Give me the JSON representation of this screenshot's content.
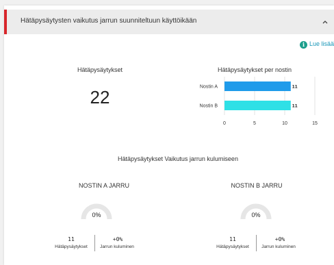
{
  "panel": {
    "title": "Hätäpysäytysten vaikutus jarrun suunniteltuun käyttöikään",
    "accent_color": "#d8262b",
    "collapse_icon": "chevron-up-icon",
    "read_more_label": "Lue lisää",
    "read_more_icon": "info-icon"
  },
  "summary": {
    "title": "Hätäpysäytykset",
    "value": "22"
  },
  "chart_data": {
    "type": "bar",
    "orientation": "horizontal",
    "title": "Hätäpysäytykset per nostin",
    "categories": [
      "Nostin A",
      "Nostin B"
    ],
    "values": [
      11,
      11
    ],
    "value_labels": [
      "11",
      "11"
    ],
    "colors": [
      "#1f9bea",
      "#2fe0e6"
    ],
    "xlim": [
      0,
      15
    ],
    "xticks": [
      "0",
      "5",
      "10",
      "15"
    ],
    "grid": true
  },
  "wear": {
    "title": "Hätäpysäytykset Vaikutus jarrun kulumiseen",
    "brakes": [
      {
        "title": "NOSTIN A JARRU",
        "gauge_value": "0%",
        "gauge_fraction": 0,
        "stops_value": "11",
        "stops_label": "Hätäpysäytykset",
        "wear_value": "+0%",
        "wear_label": "Jarrun kuluminen"
      },
      {
        "title": "NOSTIN B JARRU",
        "gauge_value": "0%",
        "gauge_fraction": 0,
        "stops_value": "11",
        "stops_label": "Hätäpysäytykset",
        "wear_value": "+0%",
        "wear_label": "Jarrun kuluminen"
      }
    ]
  }
}
